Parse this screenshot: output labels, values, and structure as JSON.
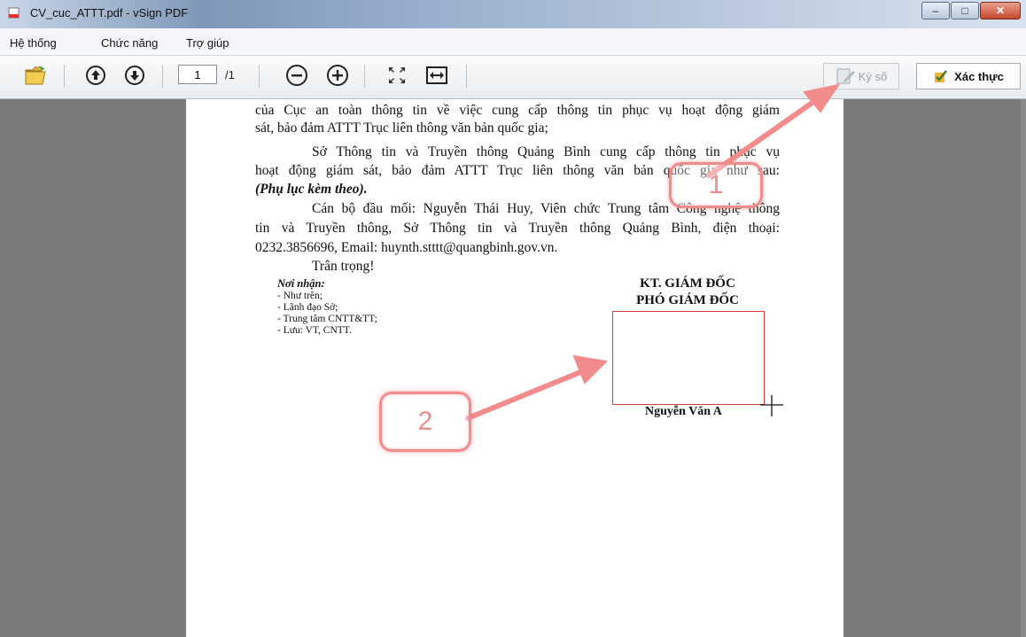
{
  "window": {
    "title": "CV_cuc_ATTT.pdf - vSign PDF"
  },
  "menu": {
    "items": [
      "Hệ thống",
      "Chức năng",
      "Trợ giúp"
    ]
  },
  "toolbar": {
    "page_value": "1",
    "page_total": "/1",
    "kyso_label": "Ký số",
    "xacthuc_label": "Xác thực",
    "icons": [
      "open-folder-icon",
      "page-up-icon",
      "page-down-icon",
      "zoom-out-icon",
      "zoom-in-icon",
      "fit-page-icon",
      "fit-width-icon",
      "sign-pen-icon",
      "verify-check-icon"
    ]
  },
  "document": {
    "para1_line1": "của Cục an toàn thông tin về việc cung cấp thông tin phục vụ hoạt động giám",
    "para1_line2": "sát, bảo đảm ATTT Trục liên thông văn bản quốc gia;",
    "para2_line1": "Sở Thông tin và Truyền thông  Quảng Bình cung cấp thông tin phục vụ",
    "para2_line2": "hoạt động giám sát, bảo đảm ATTT Trục liên thông văn bản quốc gia như sau:",
    "para2_line3": "(Phụ lục kèm theo).",
    "para3_line1": "Cán bộ đầu mối: Nguyễn Thái Huy, Viên chức Trung tâm Công nghệ thông",
    "para3_line2": "tin và Truyền thông, Sở Thông tin và Truyền thông Quảng Bình, điện thoại:",
    "para3_line3": "0232.3856696,  Email: huynth.stttt@quangbinh.gov.vn.",
    "closing": "Trân trọng!",
    "recipients_title": "Nơi nhận:",
    "recipients": [
      "- Như trên;",
      "- Lãnh đạo Sở;",
      "- Trung tâm CNTT&TT;",
      "- Lưu: VT, CNTT."
    ],
    "sig_title1": "KT. GIÁM ĐỐC",
    "sig_title2": "PHÓ GIÁM ĐỐC",
    "signer": "Nguyễn Văn A"
  },
  "annotations": {
    "callout1": "1",
    "callout2": "2",
    "color": "#f28b8b"
  }
}
